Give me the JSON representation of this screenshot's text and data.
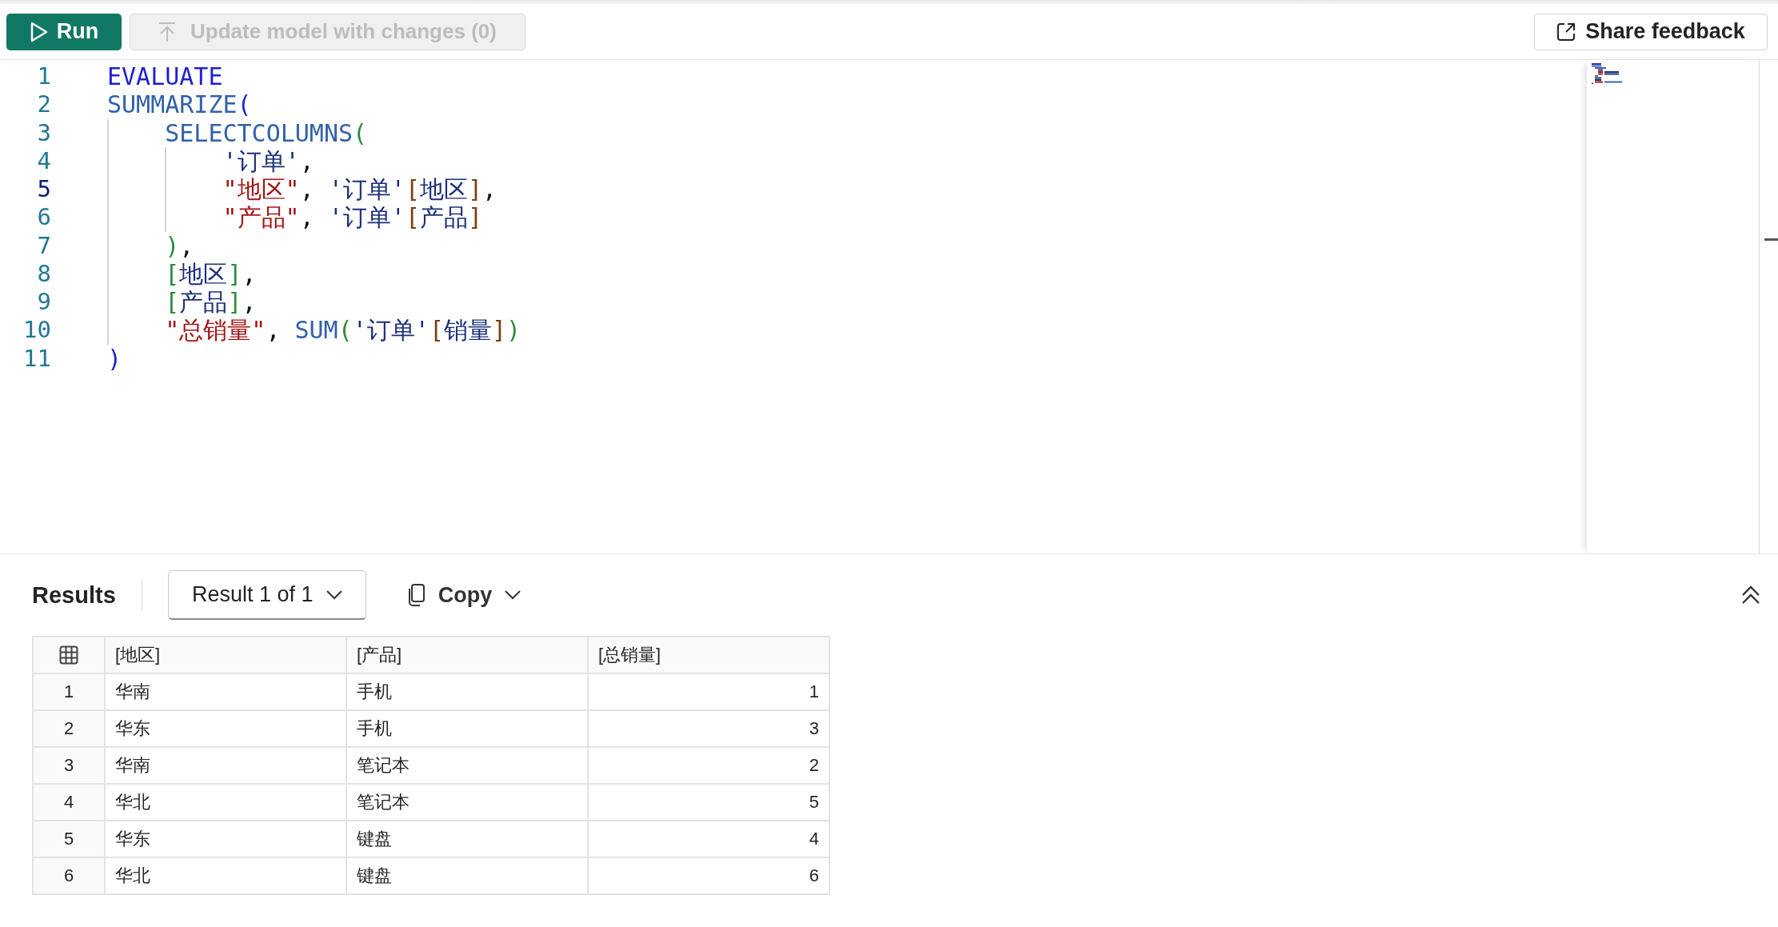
{
  "toolbar": {
    "run_button": "Run",
    "update_button": {
      "label": "Update model with changes (0)",
      "disabled": true
    },
    "feedback_button": "Share feedback"
  },
  "editor": {
    "lines": [
      {
        "number": "1",
        "current": false,
        "tokens": [
          {
            "kind": "keyword",
            "text": "EVALUATE"
          }
        ]
      },
      {
        "number": "2",
        "current": false,
        "tokens": [
          {
            "kind": "function",
            "text": "SUMMARIZE"
          },
          {
            "kind": "bracket1",
            "text": "("
          }
        ]
      },
      {
        "number": "3",
        "current": false,
        "tokens": [
          {
            "kind": "function",
            "text": "    SELECTCOLUMNS"
          },
          {
            "kind": "bracket2",
            "text": "("
          }
        ]
      },
      {
        "number": "4",
        "current": false,
        "tokens": [
          {
            "kind": "name",
            "text": "        '订单'"
          },
          {
            "kind": "punct",
            "text": ","
          }
        ]
      },
      {
        "number": "5",
        "current": true,
        "tokens": [
          {
            "kind": "string",
            "text": "        \"地区\""
          },
          {
            "kind": "punct",
            "text": ", "
          },
          {
            "kind": "name",
            "text": "'订单'"
          },
          {
            "kind": "bracket3",
            "text": "["
          },
          {
            "kind": "name",
            "text": "地区"
          },
          {
            "kind": "bracket3",
            "text": "]"
          },
          {
            "kind": "punct",
            "text": ","
          }
        ]
      },
      {
        "number": "6",
        "current": false,
        "tokens": [
          {
            "kind": "string",
            "text": "        \"产品\""
          },
          {
            "kind": "punct",
            "text": ", "
          },
          {
            "kind": "name",
            "text": "'订单'"
          },
          {
            "kind": "bracket3",
            "text": "["
          },
          {
            "kind": "name",
            "text": "产品"
          },
          {
            "kind": "bracket3",
            "text": "]"
          }
        ]
      },
      {
        "number": "7",
        "current": false,
        "tokens": [
          {
            "kind": "bracket2",
            "text": "    )"
          },
          {
            "kind": "punct",
            "text": ","
          }
        ]
      },
      {
        "number": "8",
        "current": false,
        "tokens": [
          {
            "kind": "bracket2",
            "text": "    ["
          },
          {
            "kind": "name",
            "text": "地区"
          },
          {
            "kind": "bracket2",
            "text": "]"
          },
          {
            "kind": "punct",
            "text": ","
          }
        ]
      },
      {
        "number": "9",
        "current": false,
        "tokens": [
          {
            "kind": "bracket2",
            "text": "    ["
          },
          {
            "kind": "name",
            "text": "产品"
          },
          {
            "kind": "bracket2",
            "text": "]"
          },
          {
            "kind": "punct",
            "text": ","
          }
        ]
      },
      {
        "number": "10",
        "current": false,
        "tokens": [
          {
            "kind": "string",
            "text": "    \"总销量\""
          },
          {
            "kind": "punct",
            "text": ", "
          },
          {
            "kind": "function",
            "text": "SUM"
          },
          {
            "kind": "bracket2",
            "text": "("
          },
          {
            "kind": "name",
            "text": "'订单'"
          },
          {
            "kind": "bracket3",
            "text": "["
          },
          {
            "kind": "name",
            "text": "销量"
          },
          {
            "kind": "bracket3",
            "text": "]"
          },
          {
            "kind": "bracket2",
            "text": ")"
          }
        ]
      },
      {
        "number": "11",
        "current": false,
        "tokens": [
          {
            "kind": "bracket1",
            "text": ")"
          }
        ]
      }
    ]
  },
  "results": {
    "title": "Results",
    "result_picker": "Result 1 of 1",
    "copy_button": "Copy",
    "table": {
      "columns": [
        "[地区]",
        "[产品]",
        "[总销量]"
      ],
      "rows": [
        {
          "number": "1",
          "cells": [
            "华南",
            "手机",
            "1"
          ]
        },
        {
          "number": "2",
          "cells": [
            "华东",
            "手机",
            "3"
          ]
        },
        {
          "number": "3",
          "cells": [
            "华南",
            "笔记本",
            "2"
          ]
        },
        {
          "number": "4",
          "cells": [
            "华北",
            "笔记本",
            "5"
          ]
        },
        {
          "number": "5",
          "cells": [
            "华东",
            "键盘",
            "4"
          ]
        },
        {
          "number": "6",
          "cells": [
            "华北",
            "键盘",
            "6"
          ]
        }
      ]
    }
  }
}
